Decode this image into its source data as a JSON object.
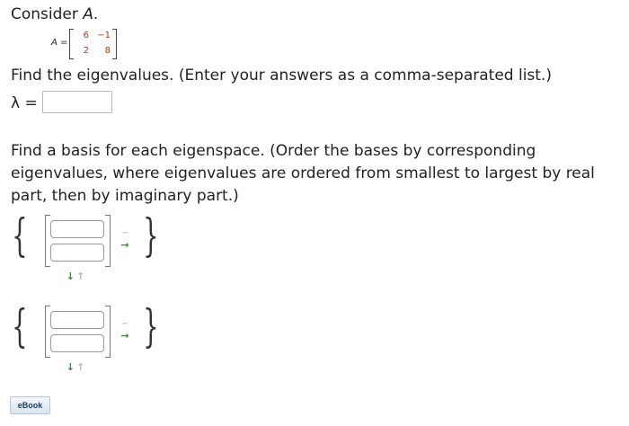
{
  "problem": {
    "heading_prefix": "Consider ",
    "heading_var": "A",
    "heading_suffix": "."
  },
  "matrix": {
    "lhs_var": "A",
    "lhs_eq": " =",
    "rows": [
      [
        "6",
        "−1"
      ],
      [
        "2",
        "8"
      ]
    ]
  },
  "question_eigenvalues": {
    "prompt": "Find the eigenvalues. (Enter your answers as a comma-separated list.)",
    "label": "λ =",
    "input_value": ""
  },
  "question_basis": {
    "line1": "Find a basis for each eigenspace. (Order the bases by corresponding",
    "line2": "eigenvalues, where eigenvalues are ordered from smallest to largest by real",
    "line3": "part, then by imaginary part.)"
  },
  "basis_blocks": [
    {
      "brace_left": "{",
      "brace_right": "}",
      "entries": [
        "",
        ""
      ],
      "col_minus": "−",
      "col_plus": "→",
      "row_down": "↓",
      "row_up": "↑"
    },
    {
      "brace_left": "{",
      "brace_right": "}",
      "entries": [
        "",
        ""
      ],
      "col_minus": "−",
      "col_plus": "→",
      "row_down": "↓",
      "row_up": "↑"
    }
  ],
  "ebook": {
    "label": "eBook"
  },
  "colors": {
    "matrix_entry": "#b03a1a",
    "add_control": "#3a8a3a",
    "disabled_control": "#b5b5b5"
  }
}
